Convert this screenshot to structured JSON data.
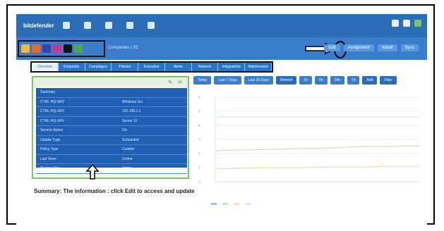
{
  "annotation": {
    "caption": "Summary: The information : click Edit to access and update"
  },
  "topbar": {
    "logo": "bitdefender",
    "nav_icons": [
      "home-icon",
      "network-icon",
      "policies-icon",
      "reports-icon",
      "settings-icon"
    ],
    "right_icons": [
      "notifications-icon",
      "user-icon",
      "help-icon"
    ],
    "colors": {
      "primary": "#2c6db8",
      "secondary": "#3a7dcc"
    }
  },
  "toolbar": {
    "context_label": "Companies / 2C",
    "right_buttons": [
      "Edit",
      "Assignment",
      "Install",
      "Sync"
    ]
  },
  "tabs": [
    "Overview",
    "Endpoints",
    "Campaigns",
    "Policies",
    "Executive",
    "Alerts",
    "Network",
    "Integrations",
    "Maintenance"
  ],
  "summary": {
    "rows": [
      {
        "k": "Summary",
        "v": ""
      },
      {
        "k": "CTRL-HQ-SRV",
        "v": "Windows Srv"
      },
      {
        "k": "CTRL-HQ-SRV",
        "v": "192.168.1.1"
      },
      {
        "k": "CTRL-HQ-SRV",
        "v": "Server 11"
      },
      {
        "k": "Service Status",
        "v": "On"
      },
      {
        "k": "Update Type",
        "v": "Scheduled"
      },
      {
        "k": "Policy Type",
        "v": "Custom"
      },
      {
        "k": "Last Seen",
        "v": "Online"
      },
      {
        "k": "Managed by",
        "v": "Admin"
      }
    ]
  },
  "chart_toolbar": {
    "buttons": [
      "Today",
      "Last 7 Days",
      "Last 30 Days",
      "Refresh",
      "1h",
      "6h",
      "24h",
      "7d",
      "Add",
      "Filter"
    ]
  },
  "chart_data": {
    "type": "line",
    "ylim": [
      0,
      6
    ],
    "y_ticks": [
      "6",
      "5",
      "4",
      "3",
      "2",
      "1",
      "0"
    ],
    "x_ticks": [
      "",
      "",
      ""
    ],
    "series": [
      {
        "values": [
          2.2,
          2.25,
          2.3,
          2.35,
          2.4,
          2.5,
          2.5,
          2.55
        ],
        "color": "#cfe3b5"
      },
      {
        "values": [
          4.6,
          4.6,
          4.6,
          4.6,
          4.6,
          4.6,
          4.6,
          4.6
        ],
        "color": "#d9e9f8"
      },
      {
        "values": [
          0.9,
          0.95,
          1.0,
          1.0,
          1.05,
          1.05,
          1.1,
          1.1
        ],
        "color": "#f3e3a6"
      }
    ],
    "legend": [
      "",
      "",
      "",
      ""
    ]
  }
}
